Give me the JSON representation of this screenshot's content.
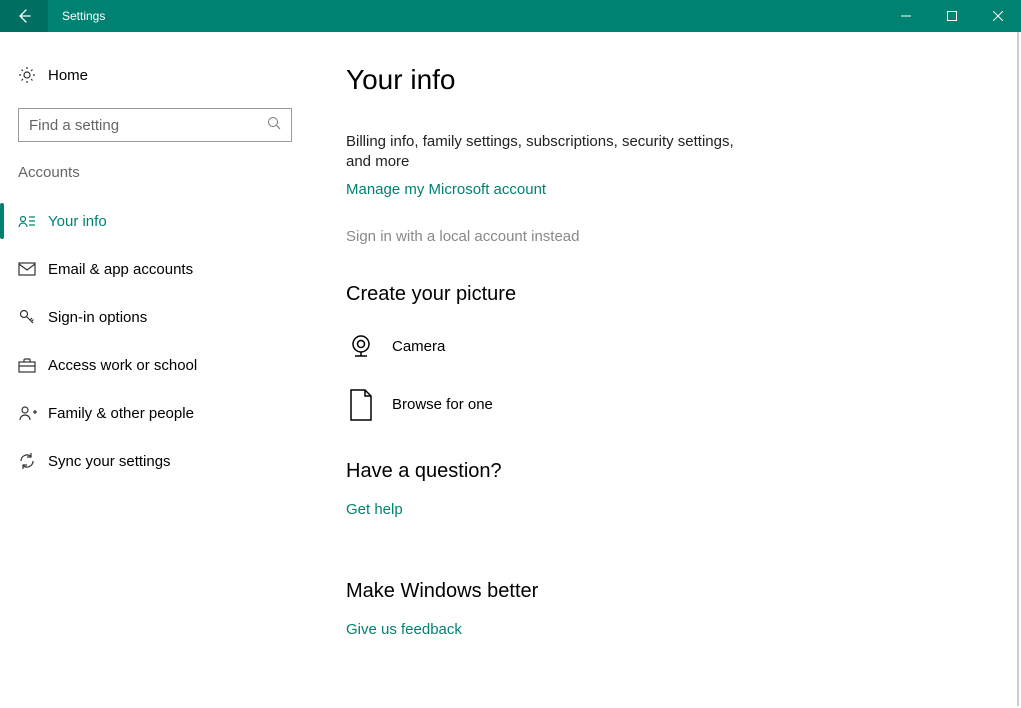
{
  "window": {
    "title": "Settings"
  },
  "colors": {
    "accent": "#008272"
  },
  "sidebar": {
    "home_label": "Home",
    "search_placeholder": "Find a setting",
    "group_label": "Accounts",
    "items": [
      {
        "label": "Your info",
        "selected": true
      },
      {
        "label": "Email & app accounts",
        "selected": false
      },
      {
        "label": "Sign-in options",
        "selected": false
      },
      {
        "label": "Access work or school",
        "selected": false
      },
      {
        "label": "Family & other people",
        "selected": false
      },
      {
        "label": "Sync your settings",
        "selected": false
      }
    ]
  },
  "main": {
    "heading": "Your info",
    "billing_desc": "Billing info, family settings, subscriptions, security settings, and more",
    "manage_link": "Manage my Microsoft account",
    "local_link": "Sign in with a local account instead",
    "picture_heading": "Create your picture",
    "camera_label": "Camera",
    "browse_label": "Browse for one",
    "question_heading": "Have a question?",
    "help_link": "Get help",
    "better_heading": "Make Windows better",
    "feedback_link": "Give us feedback"
  }
}
